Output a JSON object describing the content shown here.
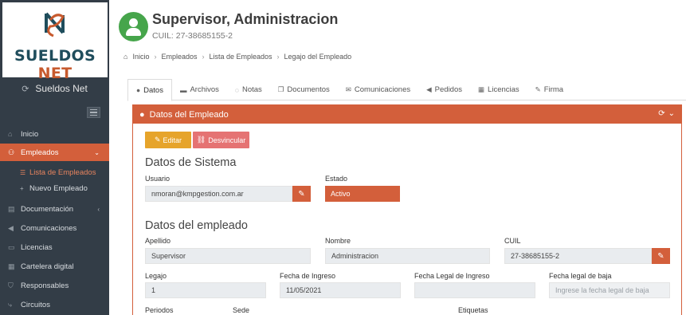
{
  "logo": {
    "part1": "SUELDOS",
    "part2": "NET"
  },
  "brand": {
    "name": "Sueldos Net",
    "icon": "refresh-icon"
  },
  "sidebar": {
    "items": [
      {
        "label": "Inicio",
        "icon": "home-icon"
      },
      {
        "label": "Empleados",
        "icon": "users-icon"
      },
      {
        "label": "Documentación",
        "icon": "document-icon"
      },
      {
        "label": "Comunicaciones",
        "icon": "megaphone-icon"
      },
      {
        "label": "Licencias",
        "icon": "license-icon"
      },
      {
        "label": "Cartelera digital",
        "icon": "board-icon"
      },
      {
        "label": "Responsables",
        "icon": "shield-icon"
      },
      {
        "label": "Circuitos",
        "icon": "circuit-icon"
      }
    ],
    "subitems": [
      {
        "label": "Lista de Empleados",
        "icon": "list-icon"
      },
      {
        "label": "Nuevo Empleado",
        "icon": "plus-icon"
      }
    ]
  },
  "header": {
    "title": "Supervisor, Administracion",
    "subtitle": "CUIL: 27-38685155-2"
  },
  "breadcrumb": [
    "Inicio",
    "Empleados",
    "Lista de Empleados",
    "Legajo del Empleado"
  ],
  "tabs": [
    {
      "label": "Datos",
      "icon": "user-icon"
    },
    {
      "label": "Archivos",
      "icon": "folder-icon"
    },
    {
      "label": "Notas",
      "icon": "comments-icon"
    },
    {
      "label": "Documentos",
      "icon": "documents-icon"
    },
    {
      "label": "Comunicaciones",
      "icon": "envelope-icon"
    },
    {
      "label": "Pedidos",
      "icon": "bullhorn-icon"
    },
    {
      "label": "Licencias",
      "icon": "calendar-icon"
    },
    {
      "label": "Firma",
      "icon": "pen-icon"
    }
  ],
  "panel": {
    "title": "Datos del Empleado",
    "edit_label": "Editar",
    "desvincular_label": "Desvincular"
  },
  "sistema": {
    "title": "Datos de Sistema",
    "usuario_label": "Usuario",
    "usuario_value": "nmoran@kmpgestion.com.ar",
    "estado_label": "Estado",
    "estado_value": "Activo"
  },
  "empleado": {
    "title": "Datos del empleado",
    "apellido_label": "Apellido",
    "apellido_value": "Supervisor",
    "nombre_label": "Nombre",
    "nombre_value": "Administracion",
    "cuil_label": "CUIL",
    "cuil_value": "27-38685155-2",
    "legajo_label": "Legajo",
    "legajo_value": "1",
    "fecha_ingreso_label": "Fecha de Ingreso",
    "fecha_ingreso_value": "11/05/2021",
    "fecha_legal_ingreso_label": "Fecha Legal de Ingreso",
    "fecha_legal_ingreso_value": "",
    "fecha_legal_baja_label": "Fecha legal de baja",
    "fecha_legal_baja_placeholder": "Ingrese la fecha legal de baja",
    "periodos_label": "Periodos",
    "sede_label": "Sede",
    "etiquetas_label": "Etiquetas"
  },
  "colors": {
    "accent": "#d35f3b",
    "sidebar": "#333d47",
    "warning": "#e6a42b",
    "danger": "#e57373",
    "avatar": "#46a54b"
  }
}
